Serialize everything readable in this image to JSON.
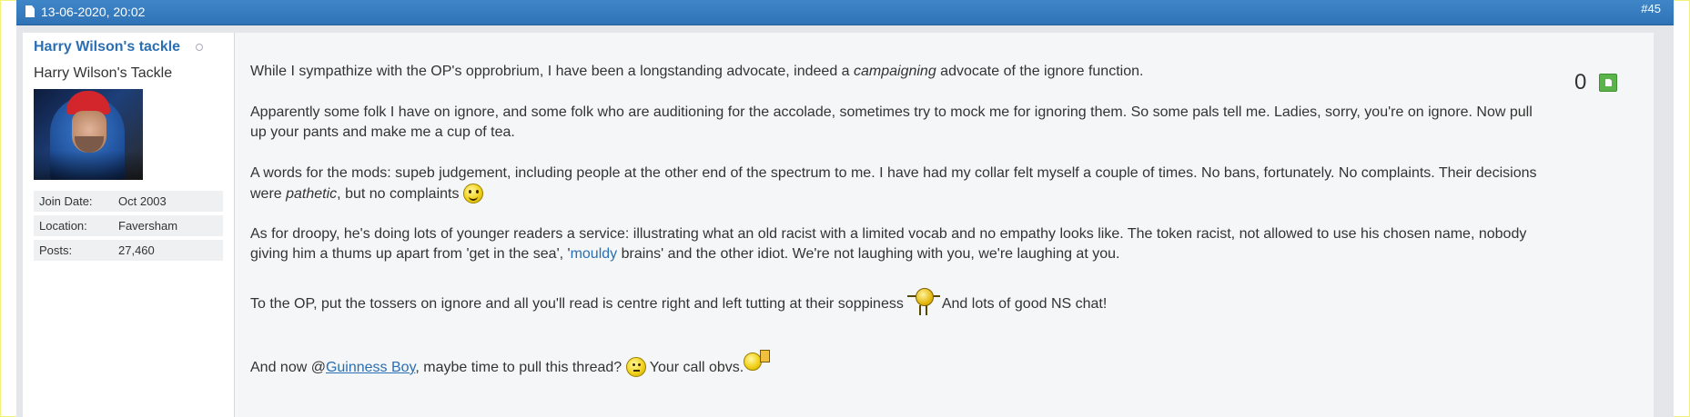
{
  "post": {
    "date": "13-06-2020, 20:02",
    "number": "#45"
  },
  "user": {
    "name": "Harry Wilson's tackle",
    "title": "Harry Wilson's Tackle",
    "info": [
      {
        "label": "Join Date:",
        "value": "Oct 2003"
      },
      {
        "label": "Location:",
        "value": "Faversham"
      },
      {
        "label": "Posts:",
        "value": "27,460"
      }
    ]
  },
  "reputation": {
    "count": "0"
  },
  "message": {
    "p1": {
      "a": "While I sympathize with the OP's opprobrium, I have been a longstanding advocate, indeed a ",
      "em": "campaigning",
      "b": " advocate of the ignore function."
    },
    "p2": "Apparently some folk I have on ignore, and some folk who are auditioning for the accolade, sometimes try to mock me for ignoring them. So some pals tell me. Ladies, sorry, you're on ignore. Now pull up your pants and make me a cup of tea.",
    "p3": {
      "a": "A words for the mods: supeb judgement, including people at the other end of the spectrum to me. I have had my collar felt myself a couple of times. No bans, fortunately. No complaints. Their decisions were ",
      "em": "pathetic",
      "b": ", but no complaints "
    },
    "p4": {
      "a": "As for droopy, he's doing lots of younger readers a service: illustrating what an old racist with a limited vocab and no empathy looks like. The token racist, not allowed to use his chosen name, nobody giving him a thums up apart from 'get in the sea', '",
      "link": "mouldy",
      "b": " brains' and the other idiot. We're not laughing with you, we're laughing at you."
    },
    "p5": {
      "a": "To the OP, put the tossers on ignore and all you'll read is centre right and left tutting at their soppiness ",
      "b": " And lots of good NS chat!"
    },
    "p6": {
      "a": "And now @",
      "mention": "Guinness Boy",
      "b": ", maybe time to pull this thread? ",
      "c": " Your call obvs."
    }
  },
  "icons": [
    "document-icon",
    "online-status-icon",
    "grin-smiley-icon",
    "dancing-smiley-icon",
    "thinking-smiley-icon",
    "beer-smiley-icon",
    "thumbs-up-icon"
  ],
  "colors": {
    "header": "#3579bf",
    "link": "#2a6fb3",
    "rep_button": "#5bb44a"
  }
}
